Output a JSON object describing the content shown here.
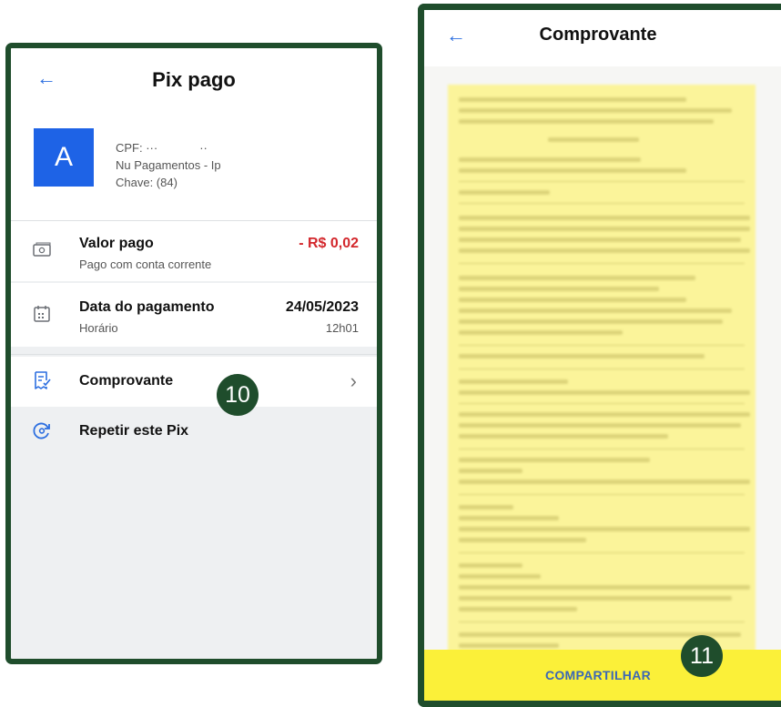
{
  "left_screen": {
    "title": "Pix pago",
    "payee": {
      "avatar_letter": "A",
      "line1": "CPF: ···",
      "line1_suffix": "··",
      "line2": "Nu Pagamentos - Ip",
      "line3": "Chave: (84)"
    },
    "valor": {
      "title": "Valor pago",
      "amount": "- R$ 0,02",
      "subtitle": "Pago com conta corrente"
    },
    "data": {
      "title": "Data do pagamento",
      "date": "24/05/2023",
      "subtitle": "Horário",
      "time": "12h01"
    },
    "comprovante": {
      "title": "Comprovante",
      "chevron": "›"
    },
    "repetir": {
      "title": "Repetir este Pix"
    },
    "badge": "10"
  },
  "right_screen": {
    "title": "Comprovante",
    "share_button": "COMPARTILHAR",
    "badge": "11"
  },
  "colors": {
    "frame": "#1f4d2c",
    "accent_blue": "#2d6fe0",
    "amount_red": "#d3272c",
    "receipt_highlight": "#fbf49a",
    "share_bar": "#fbf039"
  },
  "icons": [
    "back-arrow-icon",
    "money-icon",
    "calendar-icon",
    "receipt-icon",
    "repeat-icon",
    "chevron-right-icon"
  ]
}
